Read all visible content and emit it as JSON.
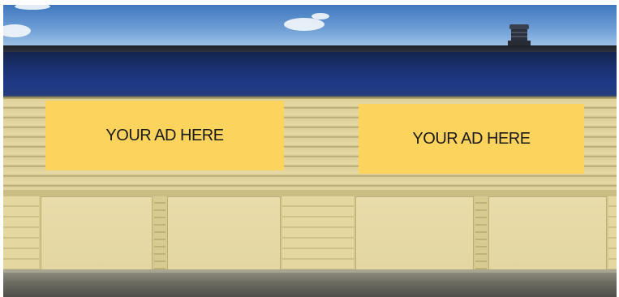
{
  "ads": [
    {
      "label": "YOUR AD HERE"
    },
    {
      "label": "YOUR AD HERE"
    }
  ],
  "colors": {
    "ad_panel": "#fcd35d",
    "ad_text": "#1a1a1a",
    "fascia": "#1e3a86",
    "siding": "#ded09a",
    "sky": "#4a82c4"
  }
}
